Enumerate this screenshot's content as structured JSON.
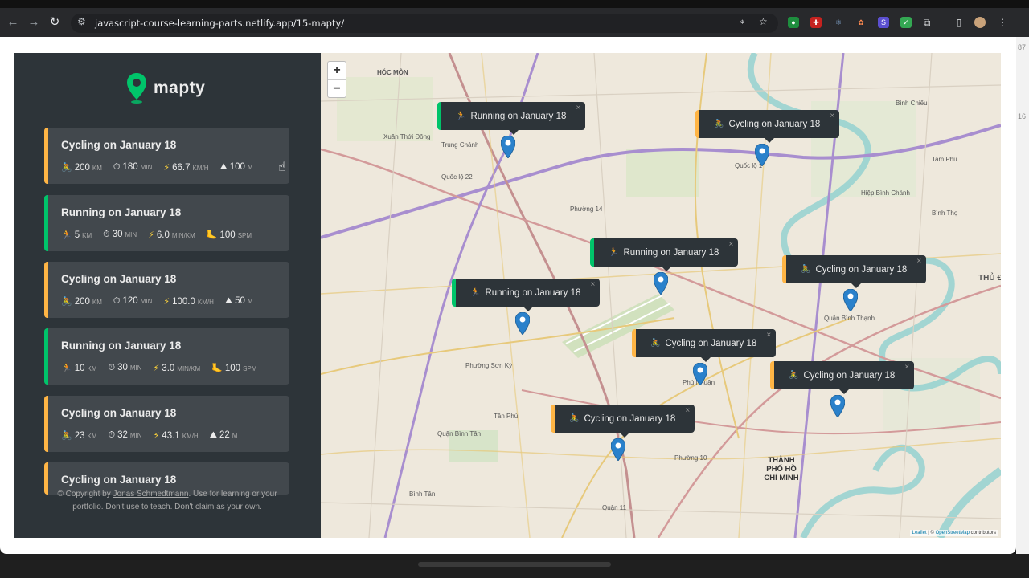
{
  "browser": {
    "url": "javascript-course-learning-parts.netlify.app/15-mapty/"
  },
  "sidebar": {
    "logo_text": "mapty",
    "workouts": [
      {
        "type": "cycling",
        "title": "Cycling on January 18",
        "icon1": "🚴",
        "distance": "200",
        "distance_unit": "KM",
        "duration": "180",
        "duration_unit": "MIN",
        "speed": "66.7",
        "speed_unit": "KM/H",
        "extra_icon": "⛰",
        "extra": "100",
        "extra_unit": "M"
      },
      {
        "type": "running",
        "title": "Running on January 18",
        "icon1": "🏃",
        "distance": "5",
        "distance_unit": "KM",
        "duration": "30",
        "duration_unit": "MIN",
        "speed": "6.0",
        "speed_unit": "MIN/KM",
        "extra_icon": "🦶",
        "extra": "100",
        "extra_unit": "SPM"
      },
      {
        "type": "cycling",
        "title": "Cycling on January 18",
        "icon1": "🚴",
        "distance": "200",
        "distance_unit": "KM",
        "duration": "120",
        "duration_unit": "MIN",
        "speed": "100.0",
        "speed_unit": "KM/H",
        "extra_icon": "⛰",
        "extra": "50",
        "extra_unit": "M"
      },
      {
        "type": "running",
        "title": "Running on January 18",
        "icon1": "🏃",
        "distance": "10",
        "distance_unit": "KM",
        "duration": "30",
        "duration_unit": "MIN",
        "speed": "3.0",
        "speed_unit": "MIN/KM",
        "extra_icon": "🦶",
        "extra": "100",
        "extra_unit": "SPM"
      },
      {
        "type": "cycling",
        "title": "Cycling on January 18",
        "icon1": "🚴",
        "distance": "23",
        "distance_unit": "KM",
        "duration": "32",
        "duration_unit": "MIN",
        "speed": "43.1",
        "speed_unit": "KM/H",
        "extra_icon": "⛰",
        "extra": "22",
        "extra_unit": "M"
      },
      {
        "type": "cycling",
        "title": "Cycling on January 18"
      }
    ],
    "copyright_prefix": "© Copyright by ",
    "copyright_author": "Jonas Schmedtmann",
    "copyright_suffix": ". Use for learning or your",
    "copyright_line2": "portfolio. Don't use to teach. Don't claim as your own."
  },
  "map": {
    "zoom_in": "+",
    "zoom_out": "−",
    "labels": [
      "HÓC MÔN",
      "Xuân Thới Đông",
      "Trung Chánh",
      "Quốc lộ 1",
      "Quốc lộ 22",
      "Phường 14",
      "Bình Chiểu",
      "Tam Phú",
      "Hiệp Bình Chánh",
      "Bình Thọ",
      "THỦ Đ",
      "Quận Bình Thạnh",
      "Phường Sơn Kỳ",
      "Quận Bình Tân",
      "Tân Phú",
      "Phường 10",
      "THÀNH PHỐ HỒ CHÍ MINH",
      "Quận 11",
      "Bình Tân",
      "Phú Nhuận"
    ],
    "popups": [
      {
        "type": "running",
        "label": "Running on January 18"
      },
      {
        "type": "cycling",
        "label": "Cycling on January 18"
      },
      {
        "type": "running",
        "label": "Running on January 18"
      },
      {
        "type": "cycling",
        "label": "Cycling on January 18"
      },
      {
        "type": "running",
        "label": "Running on January 18"
      },
      {
        "type": "cycling",
        "label": "Cycling on January 18"
      },
      {
        "type": "cycling",
        "label": "Cycling on January 18"
      },
      {
        "type": "cycling",
        "label": "Cycling on January 18"
      }
    ],
    "attribution_leaflet": "Leaflet",
    "attribution_sep": " | © ",
    "attribution_osm": "OpenStreetMap",
    "attribution_suffix": " contributors"
  },
  "colors": {
    "cycling": "#ffb545",
    "running": "#00c46a",
    "marker": "#2a81cb"
  },
  "gutter_numbers": [
    "87",
    "16"
  ]
}
